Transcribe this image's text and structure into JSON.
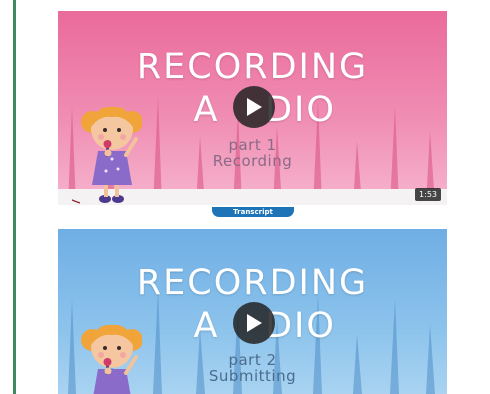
{
  "videos": [
    {
      "title_line1": "RECORDING",
      "title_line2_left": "A",
      "title_line2_right": "DIO",
      "part": "part 1",
      "subtitle": "Recording",
      "duration": "1:53",
      "theme": "pink"
    },
    {
      "title_line1": "RECORDING",
      "title_line2_left": "A",
      "title_line2_right": "DIO",
      "part": "part 2",
      "subtitle": "Submitting",
      "theme": "blue"
    }
  ],
  "transcript_label": "Transcript",
  "colors": {
    "accent_bar": "#3e8a5e",
    "pink_background": "#ea6b9b",
    "blue_background": "#6faee4",
    "transcript_button": "#1f74b8"
  },
  "icons": [
    "play-icon",
    "microphone-icon"
  ]
}
